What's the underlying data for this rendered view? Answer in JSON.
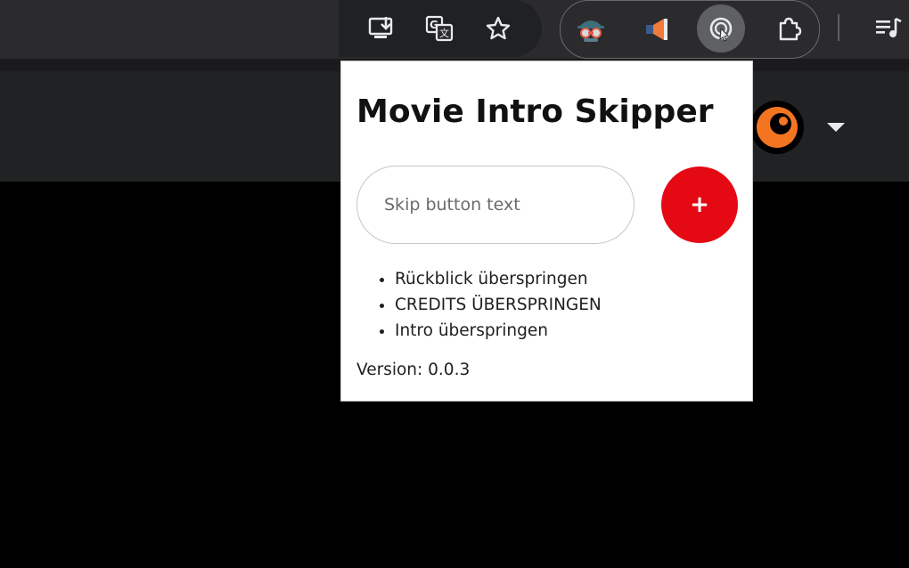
{
  "toolbar": {
    "icons": [
      {
        "name": "install-app-icon"
      },
      {
        "name": "translate-icon"
      },
      {
        "name": "bookmark-star-icon"
      },
      {
        "name": "extension-spy-icon"
      },
      {
        "name": "extension-megaphone-icon"
      },
      {
        "name": "movie-intro-skipper-extension-icon",
        "active": true
      },
      {
        "name": "extensions-puzzle-icon"
      },
      {
        "name": "media-queue-icon"
      }
    ]
  },
  "popup": {
    "title": "Movie Intro Skipper",
    "input": {
      "value": "",
      "placeholder": "Skip button text"
    },
    "add_label": "+",
    "items": [
      "Rückblick überspringen",
      "CREDITS ÜBERSPRINGEN",
      "Intro überspringen"
    ],
    "version_label": "Version:",
    "version": "0.0.3"
  },
  "colors": {
    "accent": "#e50914",
    "toolbar_bg": "#2b2b2d",
    "page_header_bg": "#202223",
    "logo_orange": "#f47521"
  }
}
